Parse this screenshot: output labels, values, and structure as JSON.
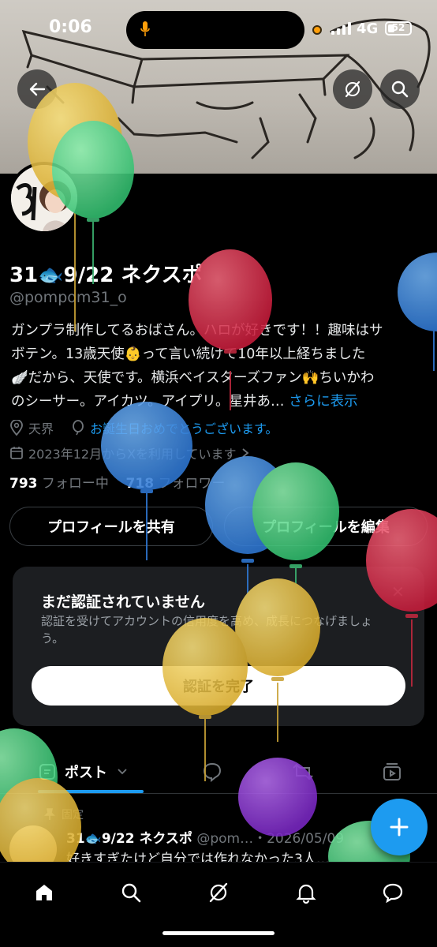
{
  "status_bar": {
    "time": "0:06",
    "network": "4G",
    "battery": "52"
  },
  "profile": {
    "display_name": "31🐟9/22 ネクスポ",
    "handle": "@pompom31_o",
    "bio_lines": [
      "ガンプラ制作してるおばさん。ハロが好きです！！趣味はサ",
      "ボテン。13歳天使👶って言い続けて10年以上経ちました",
      "🪽だから、天使です。横浜ベイスターズファン🙌ちいかわ",
      "のシーサー。アイカツ。アイプリ。星井あ…"
    ],
    "bio_more": "さらに表示",
    "location": "天界",
    "birthday": "お誕生日おめでとうございます。",
    "joined": "2023年12月からXを利用しています",
    "following_count": "793",
    "following_label": "フォロー中",
    "followers_count": "718",
    "followers_label": "フォロワー"
  },
  "actions": {
    "share": "プロフィールを共有",
    "edit": "プロフィールを編集"
  },
  "verify_card": {
    "title": "まだ認証されていません",
    "description": "認証を受けてアカウントの信用度を高め、成長につなげましょう。",
    "button": "認証を完了"
  },
  "tabs": {
    "posts_label": "ポスト"
  },
  "pinned_post": {
    "pinned_label": "固定",
    "author": "31🐟9/22 ネクスポ",
    "meta": "@pom…・2026/05/09",
    "text": "好きすぎたけど自分では作れなかった3人…"
  },
  "colors": {
    "accent": "#1d9bf0",
    "background": "#000000",
    "card": "#1c1e21",
    "muted": "#71767b"
  },
  "icons": {
    "back": "arrow-left-icon",
    "grok": "grok-icon",
    "search": "search-icon",
    "compose": "plus-icon",
    "nav": [
      "home-icon",
      "search-icon",
      "grok-icon",
      "bell-icon",
      "messages-icon"
    ]
  }
}
